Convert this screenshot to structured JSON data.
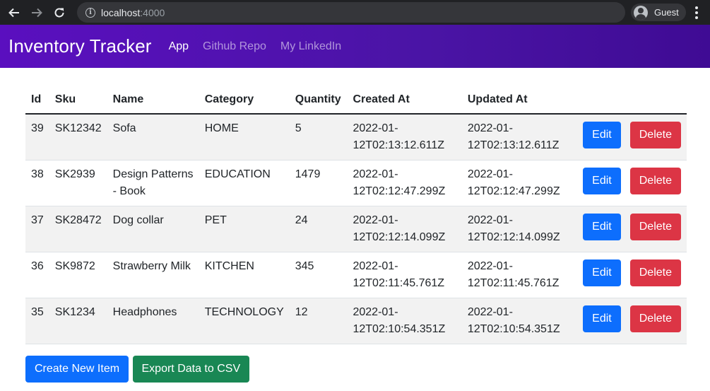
{
  "browser": {
    "host": "localhost",
    "port": ":4000",
    "profile_label": "Guest"
  },
  "navbar": {
    "brand": "Inventory Tracker",
    "links": [
      {
        "label": "App",
        "active": true
      },
      {
        "label": "Github Repo",
        "active": false
      },
      {
        "label": "My LinkedIn",
        "active": false
      }
    ]
  },
  "table": {
    "headers": [
      "Id",
      "Sku",
      "Name",
      "Category",
      "Quantity",
      "Created At",
      "Updated At"
    ],
    "rows": [
      {
        "id": "39",
        "sku": "SK12342",
        "name": "Sofa",
        "category": "HOME",
        "quantity": "5",
        "created_at": "2022-01-12T02:13:12.611Z",
        "updated_at": "2022-01-12T02:13:12.611Z"
      },
      {
        "id": "38",
        "sku": "SK2939",
        "name": "Design Patterns - Book",
        "category": "EDUCATION",
        "quantity": "1479",
        "created_at": "2022-01-12T02:12:47.299Z",
        "updated_at": "2022-01-12T02:12:47.299Z"
      },
      {
        "id": "37",
        "sku": "SK28472",
        "name": "Dog collar",
        "category": "PET",
        "quantity": "24",
        "created_at": "2022-01-12T02:12:14.099Z",
        "updated_at": "2022-01-12T02:12:14.099Z"
      },
      {
        "id": "36",
        "sku": "SK9872",
        "name": "Strawberry Milk",
        "category": "KITCHEN",
        "quantity": "345",
        "created_at": "2022-01-12T02:11:45.761Z",
        "updated_at": "2022-01-12T02:11:45.761Z"
      },
      {
        "id": "35",
        "sku": "SK1234",
        "name": "Headphones",
        "category": "TECHNOLOGY",
        "quantity": "12",
        "created_at": "2022-01-12T02:10:54.351Z",
        "updated_at": "2022-01-12T02:10:54.351Z"
      }
    ],
    "edit_label": "Edit",
    "delete_label": "Delete"
  },
  "actions": {
    "create_label": "Create New Item",
    "export_label": "Export Data to CSV"
  },
  "colors": {
    "navbar": "#4a14a5",
    "primary": "#0d6efd",
    "danger": "#dc3545",
    "success": "#198754"
  }
}
